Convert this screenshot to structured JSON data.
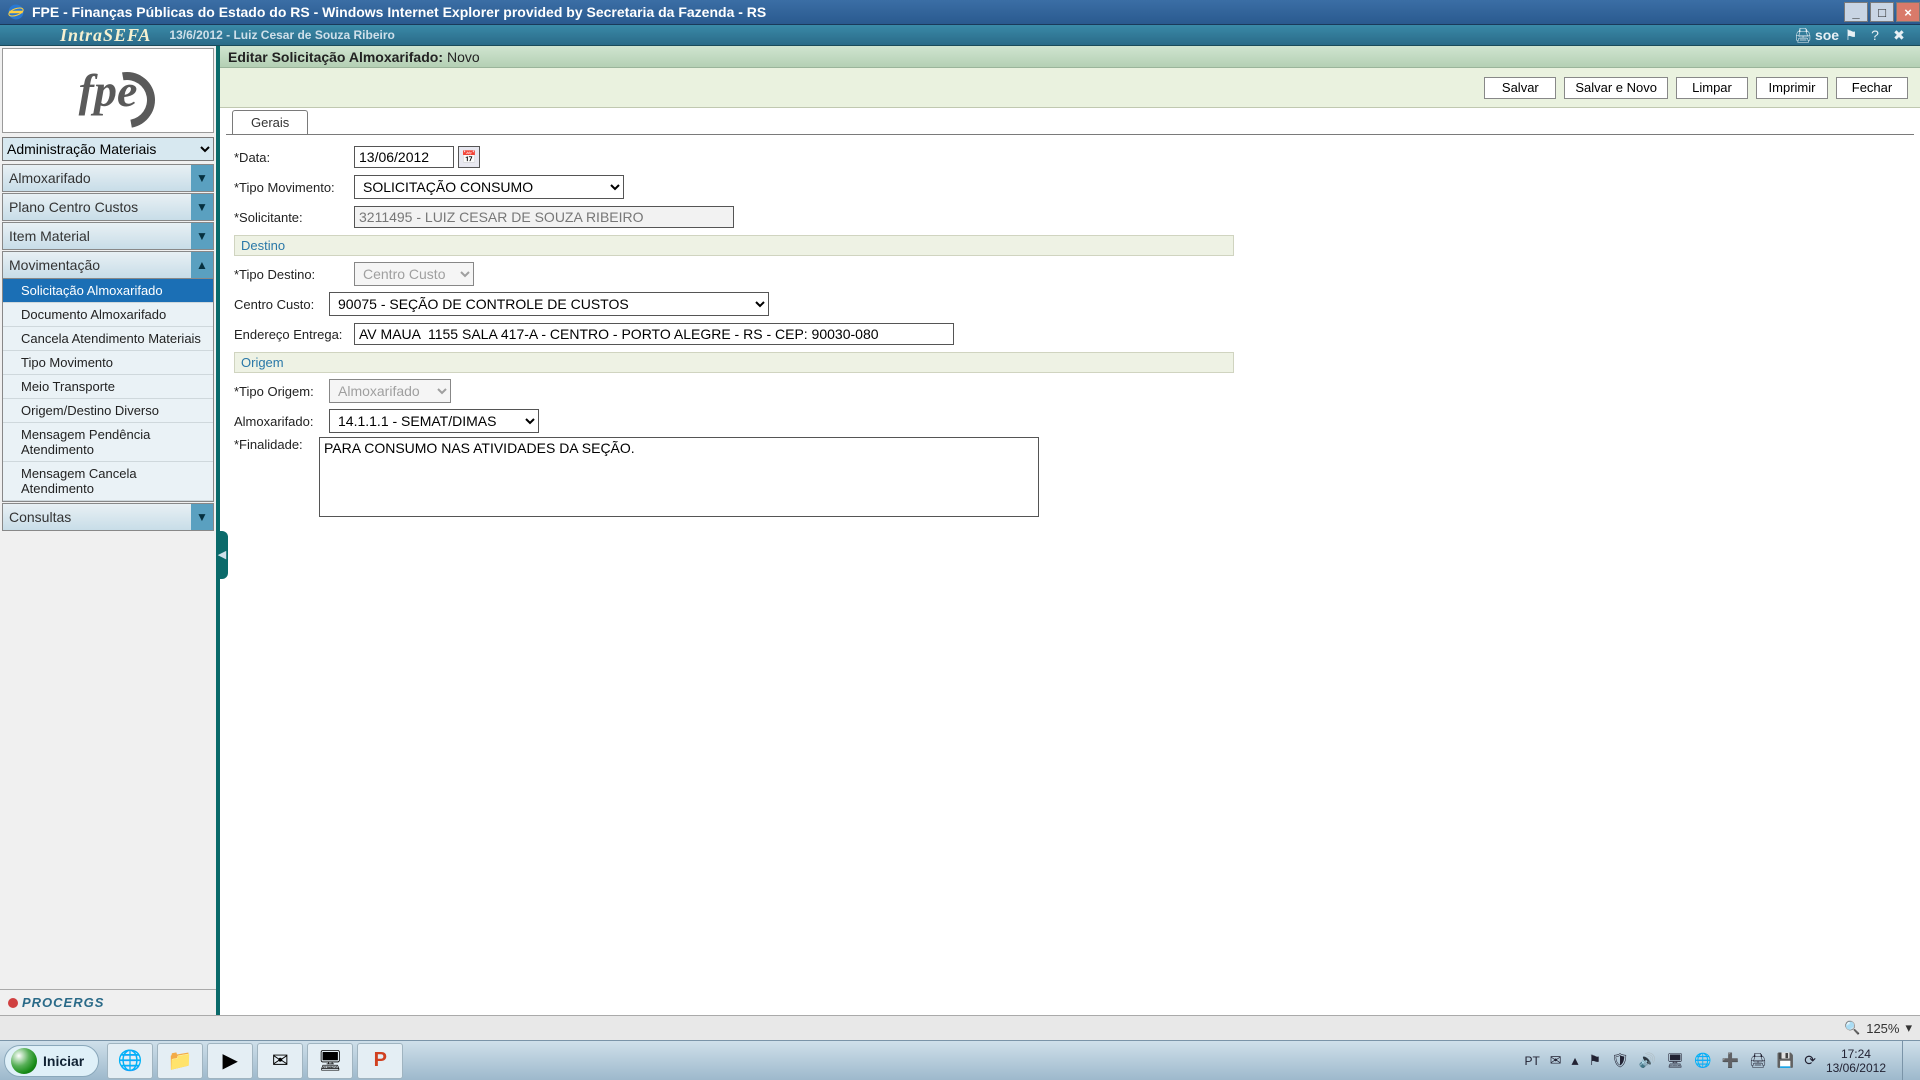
{
  "window": {
    "title": "FPE - Finanças Públicas do Estado do RS - Windows Internet Explorer provided by Secretaria da Fazenda - RS"
  },
  "intrasefa": {
    "brand": "IntraSEFA",
    "session": "13/6/2012 - Luiz Cesar de Souza Ribeiro",
    "soe_label": "soe",
    "icons": [
      "print-icon",
      "flag-icon",
      "help-icon",
      "close-icon"
    ]
  },
  "sidebar": {
    "logo_text": "fpe",
    "module": "Administração Materiais",
    "menu": [
      {
        "label": "Almoxarifado",
        "expanded": false
      },
      {
        "label": "Plano Centro Custos",
        "expanded": false
      },
      {
        "label": "Item Material",
        "expanded": false
      },
      {
        "label": "Movimentação",
        "expanded": true,
        "children": [
          {
            "label": "Solicitação Almoxarifado",
            "selected": true
          },
          {
            "label": "Documento Almoxarifado"
          },
          {
            "label": "Cancela Atendimento Materiais"
          },
          {
            "label": "Tipo Movimento"
          },
          {
            "label": "Meio Transporte"
          },
          {
            "label": "Origem/Destino Diverso"
          },
          {
            "label": "Mensagem Pendência Atendimento"
          },
          {
            "label": "Mensagem Cancela Atendimento"
          }
        ]
      },
      {
        "label": "Consultas",
        "expanded": false
      }
    ],
    "footer": "PROCERGS"
  },
  "content": {
    "subheader_label": "Editar Solicitação Almoxarifado:",
    "subheader_state": "Novo",
    "toolbar": {
      "salvar": "Salvar",
      "salvar_novo": "Salvar e Novo",
      "limpar": "Limpar",
      "imprimir": "Imprimir",
      "fechar": "Fechar"
    },
    "tab": "Gerais",
    "form": {
      "data_label": "*Data:",
      "data_value": "13/06/2012",
      "tipo_mov_label": "*Tipo Movimento:",
      "tipo_mov_value": "SOLICITAÇÃO CONSUMO",
      "solicitante_label": "*Solicitante:",
      "solicitante_value": "3211495 - LUIZ CESAR DE SOUZA RIBEIRO",
      "section_destino": "Destino",
      "tipo_destino_label": "*Tipo Destino:",
      "tipo_destino_value": "Centro Custo",
      "centro_custo_label": "Centro Custo:",
      "centro_custo_value": "90075 - SEÇÃO DE CONTROLE DE CUSTOS",
      "endereco_label": "Endereço Entrega:",
      "endereco_value": "AV MAUA  1155 SALA 417-A - CENTRO - PORTO ALEGRE - RS - CEP: 90030-080",
      "section_origem": "Origem",
      "tipo_origem_label": "*Tipo Origem:",
      "tipo_origem_value": "Almoxarifado",
      "almox_label": "Almoxarifado:",
      "almox_value": "14.1.1.1 - SEMAT/DIMAS",
      "finalidade_label": "*Finalidade:",
      "finalidade_value": "PARA CONSUMO NAS ATIVIDADES DA SEÇÃO."
    }
  },
  "statusbar": {
    "zoom_label": "125%"
  },
  "taskbar": {
    "start": "Iniciar",
    "lang": "PT",
    "time": "17:24",
    "date": "13/06/2012",
    "quick": [
      {
        "name": "ie-icon",
        "glyph": "🌐"
      },
      {
        "name": "explorer-icon",
        "glyph": "📁"
      },
      {
        "name": "wmp-icon",
        "glyph": "▶"
      },
      {
        "name": "outlook-icon",
        "glyph": "✉"
      },
      {
        "name": "app-icon",
        "glyph": "🖥"
      },
      {
        "name": "powerpoint-icon",
        "glyph": "P"
      }
    ],
    "tray_icons": [
      "flag-icon",
      "shield-icon",
      "sound-icon",
      "display-icon",
      "network-icon",
      "plus-icon",
      "printer-icon",
      "device-icon",
      "updates-icon"
    ]
  }
}
